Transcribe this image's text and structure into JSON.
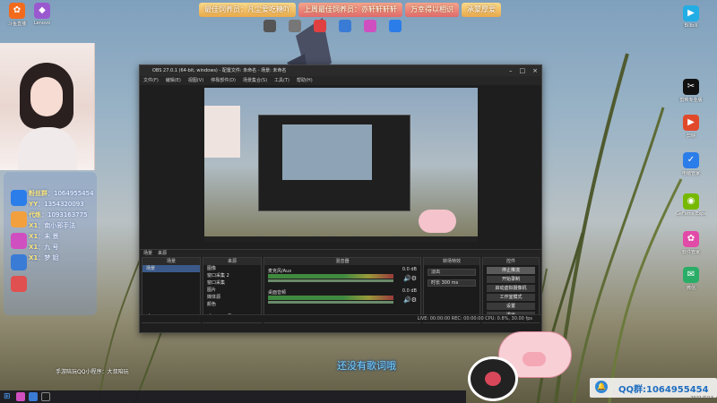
{
  "banner": {
    "segments": [
      "最佳饲养员：凡尘爱吃糖吖",
      "上周最佳饲养员：亦轩轩轩轩",
      "万幸得以相识",
      "承蒙厚爱"
    ]
  },
  "desktop_left": {
    "icons": [
      {
        "label": "斗鱼直播",
        "icon": "douyu-icon",
        "color": "#f26b1d"
      },
      {
        "label": "Lenovo",
        "icon": "lenovo-icon",
        "color": "#9b59d0"
      }
    ]
  },
  "desktop_top": {
    "icons": [
      {
        "label": "",
        "icon": "app-icon",
        "color": "#555"
      },
      {
        "label": "",
        "icon": "app-icon",
        "color": "#777"
      },
      {
        "label": "",
        "icon": "app-icon",
        "color": "#e04040"
      },
      {
        "label": "",
        "icon": "app-icon",
        "color": "#3a7bd5"
      },
      {
        "label": "",
        "icon": "app-icon",
        "color": "#d04fc0"
      },
      {
        "label": "",
        "icon": "app-icon",
        "color": "#2b7de9"
      }
    ]
  },
  "info_panel": {
    "lines": [
      {
        "key": "粉丝群",
        "value": "1064955454"
      },
      {
        "key": "YY",
        "value": "1354320093"
      },
      {
        "key": "代练",
        "value": "1093163775"
      },
      {
        "key": "X1",
        "value": "南小邪手法"
      },
      {
        "key": "X1",
        "value": "未 景"
      },
      {
        "key": "X1",
        "value": "九 号"
      },
      {
        "key": "X1",
        "value": "梦 姐"
      }
    ],
    "bottom_note": "手游陪玩QQ小程序：大叔陪玩"
  },
  "obs": {
    "title": "OBS 27.0.1 (64-bit, windows) - 配置文件: 未命名 - 场景: 未命名",
    "menu": [
      "文件(F)",
      "编辑(E)",
      "视图(V)",
      "停靠部件(D)",
      "场景集合(S)",
      "工具(T)",
      "帮助(H)"
    ],
    "scene_tabs": [
      "场景",
      "来源",
      "混音器",
      "转场特效",
      "控件"
    ],
    "scenes_header": "场景",
    "scenes": [
      "场景"
    ],
    "sources_header": "来源",
    "sources": [
      "图像",
      "窗口采集 2",
      "窗口采集",
      "图片",
      "媒体源",
      "颜色"
    ],
    "mixer_header": "混音器",
    "mixer": [
      {
        "name": "麦克风/Aux",
        "db": "0.0 dB"
      },
      {
        "name": "桌面音频",
        "db": "0.0 dB"
      }
    ],
    "transitions_header": "转场特效",
    "transition_type": "淡出",
    "duration_label": "时长",
    "duration_value": "300 ms",
    "controls_header": "控件",
    "controls": [
      "停止推流",
      "开始录制",
      "启动虚拟摄像机",
      "工作室模式",
      "设置",
      "退出"
    ],
    "status": "LIVE: 00:00:00   REC: 00:00:00   CPU: 0.8%, 30.00 fps"
  },
  "desktop_right": {
    "icons": [
      {
        "label": "Bilibili",
        "icon": "bilibili-icon",
        "color": "#23ade5"
      },
      {
        "label": "剪映专业版",
        "icon": "capcut-icon",
        "color": "#111"
      },
      {
        "label": "剪映",
        "icon": "jianying-icon",
        "color": "#e04a2b"
      },
      {
        "label": "电脑管家",
        "icon": "security-icon",
        "color": "#2b7de9"
      },
      {
        "label": "GeForce Experience",
        "icon": "nvidia-icon",
        "color": "#76b900"
      },
      {
        "label": "软件管家",
        "icon": "software-icon",
        "color": "#e24aa8"
      },
      {
        "label": "微信",
        "icon": "wechat-icon",
        "color": "#2aae67"
      }
    ]
  },
  "lyrics": "还没有歌词哦",
  "qq_group": "QQ群:1064955454",
  "date": "2021/7/13"
}
